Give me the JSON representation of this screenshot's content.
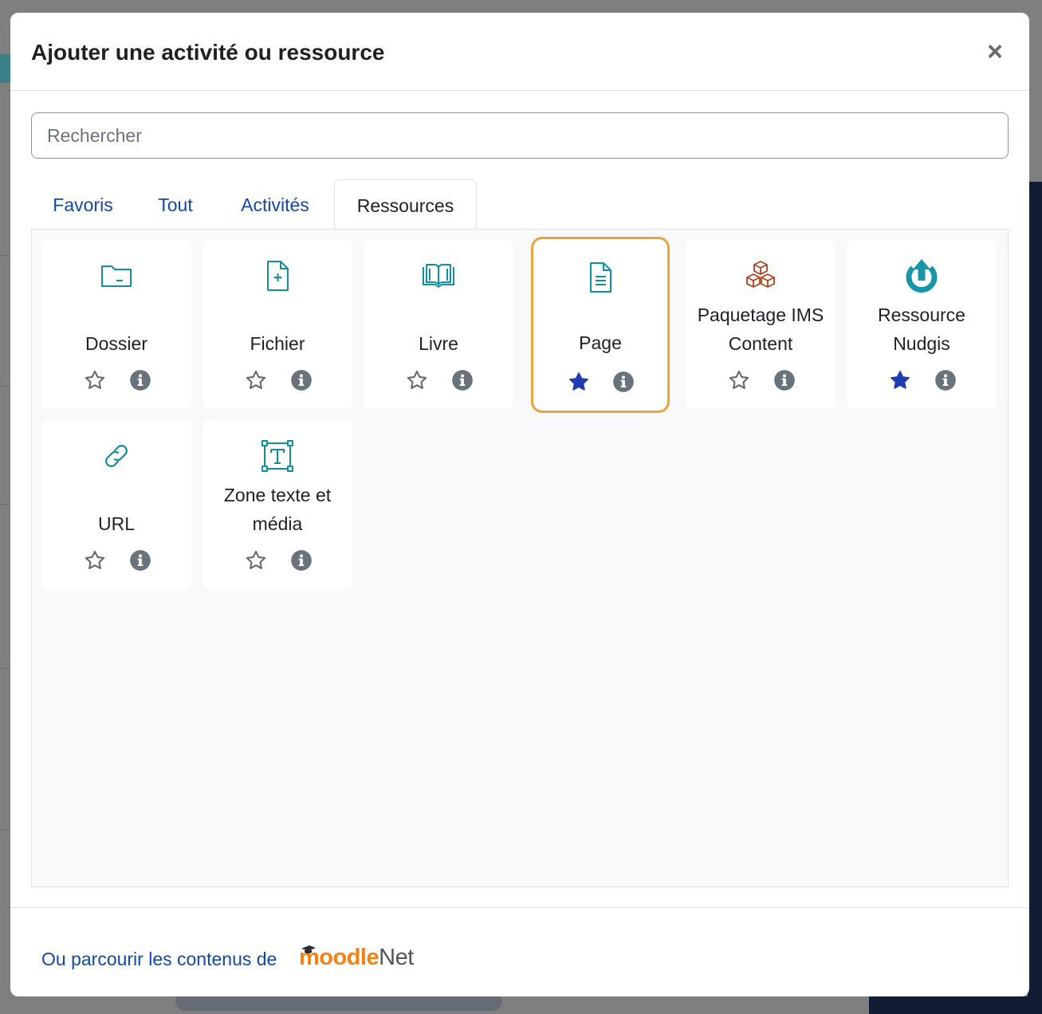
{
  "modal": {
    "title": "Ajouter une activité ou ressource",
    "close_label": "×"
  },
  "search": {
    "placeholder": "Rechercher",
    "value": ""
  },
  "tabs": [
    {
      "label": "Favoris",
      "active": false
    },
    {
      "label": "Tout",
      "active": false
    },
    {
      "label": "Activités",
      "active": false
    },
    {
      "label": "Ressources",
      "active": true
    }
  ],
  "items": [
    {
      "label": "Dossier",
      "icon": "folder-icon",
      "starred": false,
      "selected": false
    },
    {
      "label": "Fichier",
      "icon": "file-add-icon",
      "starred": false,
      "selected": false
    },
    {
      "label": "Livre",
      "icon": "book-icon",
      "starred": false,
      "selected": false
    },
    {
      "label": "Page",
      "icon": "page-icon",
      "starred": true,
      "selected": true
    },
    {
      "label": "Paquetage IMS Content",
      "icon": "boxes-icon",
      "starred": false,
      "selected": false
    },
    {
      "label": "Ressource Nudgis",
      "icon": "nudgis-icon",
      "starred": true,
      "selected": false
    },
    {
      "label": "URL",
      "icon": "link-icon",
      "starred": false,
      "selected": false
    },
    {
      "label": "Zone texte et média",
      "icon": "text-area-icon",
      "starred": false,
      "selected": false
    }
  ],
  "footer": {
    "link_text": "Ou parcourir les contenus de",
    "logo_moodle": "moodle",
    "logo_net": "Net"
  },
  "colors": {
    "icon_teal": "#0f8fa2",
    "icon_brown": "#b0421d",
    "star_filled": "#1f3db0",
    "star_outline": "#636a72",
    "info": "#6a737b",
    "selected_border": "#f0a13c",
    "link": "#0f47ad",
    "logo_orange": "#f98012"
  }
}
